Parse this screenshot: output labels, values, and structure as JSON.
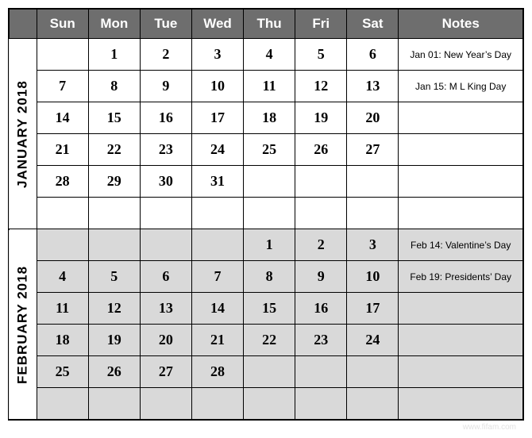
{
  "headers": {
    "days": [
      "Sun",
      "Mon",
      "Tue",
      "Wed",
      "Thu",
      "Fri",
      "Sat"
    ],
    "notes": "Notes"
  },
  "months": [
    {
      "label": "JANUARY 2018",
      "shaded": false,
      "weeks": [
        {
          "days": [
            "",
            "1",
            "2",
            "3",
            "4",
            "5",
            "6"
          ],
          "note": "Jan 01: New Year’s Day"
        },
        {
          "days": [
            "7",
            "8",
            "9",
            "10",
            "11",
            "12",
            "13"
          ],
          "note": "Jan 15: M L King Day"
        },
        {
          "days": [
            "14",
            "15",
            "16",
            "17",
            "18",
            "19",
            "20"
          ],
          "note": ""
        },
        {
          "days": [
            "21",
            "22",
            "23",
            "24",
            "25",
            "26",
            "27"
          ],
          "note": ""
        },
        {
          "days": [
            "28",
            "29",
            "30",
            "31",
            "",
            "",
            ""
          ],
          "note": ""
        },
        {
          "days": [
            "",
            "",
            "",
            "",
            "",
            "",
            ""
          ],
          "note": ""
        }
      ]
    },
    {
      "label": "FEBRUARY 2018",
      "shaded": true,
      "weeks": [
        {
          "days": [
            "",
            "",
            "",
            "",
            "1",
            "2",
            "3"
          ],
          "note": "Feb 14: Valentine’s Day"
        },
        {
          "days": [
            "4",
            "5",
            "6",
            "7",
            "8",
            "9",
            "10"
          ],
          "note": "Feb 19: Presidents’ Day"
        },
        {
          "days": [
            "11",
            "12",
            "13",
            "14",
            "15",
            "16",
            "17"
          ],
          "note": ""
        },
        {
          "days": [
            "18",
            "19",
            "20",
            "21",
            "22",
            "23",
            "24"
          ],
          "note": ""
        },
        {
          "days": [
            "25",
            "26",
            "27",
            "28",
            "",
            "",
            ""
          ],
          "note": ""
        },
        {
          "days": [
            "",
            "",
            "",
            "",
            "",
            "",
            ""
          ],
          "note": ""
        }
      ]
    }
  ],
  "watermark": "www.fifam.com"
}
